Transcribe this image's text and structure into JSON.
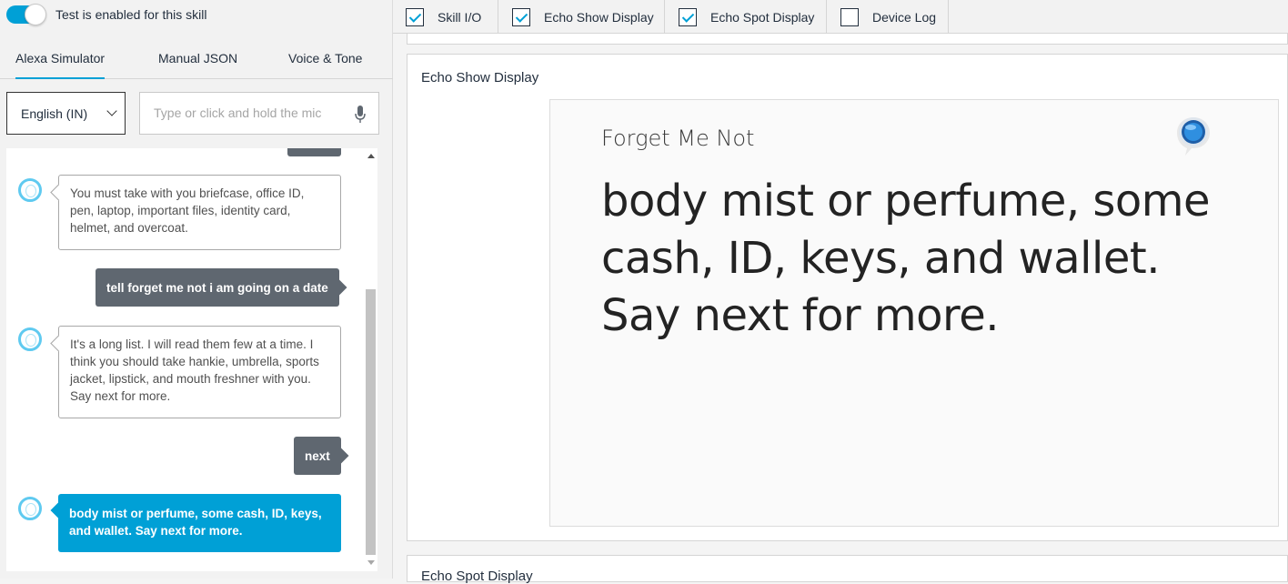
{
  "sidebar": {
    "toggle_label": "Test is enabled for this skill",
    "tabs": [
      {
        "label": "Alexa Simulator"
      },
      {
        "label": "Manual JSON"
      },
      {
        "label": "Voice & Tone"
      }
    ],
    "language": "English (IN)",
    "utterance_placeholder": "Type or click and hold the mic",
    "messages": [
      {
        "from": "alexa",
        "text": "You must take with you briefcase, office ID, pen, laptop, important files, identity card, helmet, and overcoat."
      },
      {
        "from": "user",
        "text": "tell forget me not i am going on a date"
      },
      {
        "from": "alexa",
        "text": "It's a long list. I will read them few at a time. I think you should take hankie, umbrella, sports jacket, lipstick, and mouth freshner with you. Say next for more."
      },
      {
        "from": "user",
        "text": "next"
      },
      {
        "from": "alexa",
        "text": "body mist or perfume, some cash, ID, keys, and wallet. Say next for more."
      }
    ]
  },
  "topbar": {
    "options": [
      {
        "label": "Skill I/O",
        "checked": true
      },
      {
        "label": "Echo Show Display",
        "checked": true
      },
      {
        "label": "Echo Spot Display",
        "checked": true
      },
      {
        "label": "Device Log",
        "checked": false
      }
    ]
  },
  "echo_show": {
    "panel_title": "Echo Show Display",
    "skill_title": "Forget Me Not",
    "body": "body mist or perfume, some cash, ID, keys, and wallet. Say next for more."
  },
  "echo_spot": {
    "panel_title": "Echo Spot Display"
  },
  "colors": {
    "accent": "#00a0d6",
    "user_bubble": "#5f6770"
  }
}
